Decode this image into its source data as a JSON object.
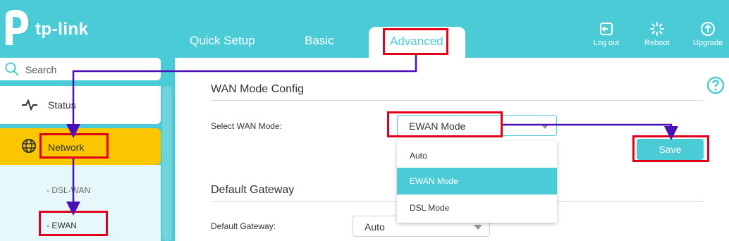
{
  "brand": {
    "logo_text": "tp-link"
  },
  "nav": {
    "tabs": [
      {
        "label": "Quick Setup"
      },
      {
        "label": "Basic"
      },
      {
        "label": "Advanced"
      }
    ]
  },
  "header_actions": [
    {
      "label": "Log out",
      "icon": "logout-icon"
    },
    {
      "label": "Reboot",
      "icon": "reboot-icon"
    },
    {
      "label": "Upgrade",
      "icon": "upgrade-icon"
    }
  ],
  "sidebar": {
    "search_placeholder": "Search",
    "items": [
      {
        "label": "Status",
        "icon": "pulse-icon"
      },
      {
        "label": "Network",
        "icon": "globe-icon"
      }
    ],
    "sub_items": [
      {
        "label": "- DSL-WAN"
      },
      {
        "label": "- EWAN"
      }
    ]
  },
  "wan_mode": {
    "section_title": "WAN Mode Config",
    "field_label": "Select WAN Mode:",
    "selected": "EWAN Mode",
    "options": [
      "Auto",
      "EWAN Mode",
      "DSL Mode"
    ]
  },
  "save_label": "Save",
  "gateway": {
    "section_title": "Default Gateway",
    "field_label": "Default Gateway:",
    "selected": "Auto"
  },
  "colors": {
    "accent": "#4acbd6",
    "highlight": "#f9c600",
    "annotation_box": "#e0001b",
    "annotation_arrow": "#4b0fb8"
  }
}
